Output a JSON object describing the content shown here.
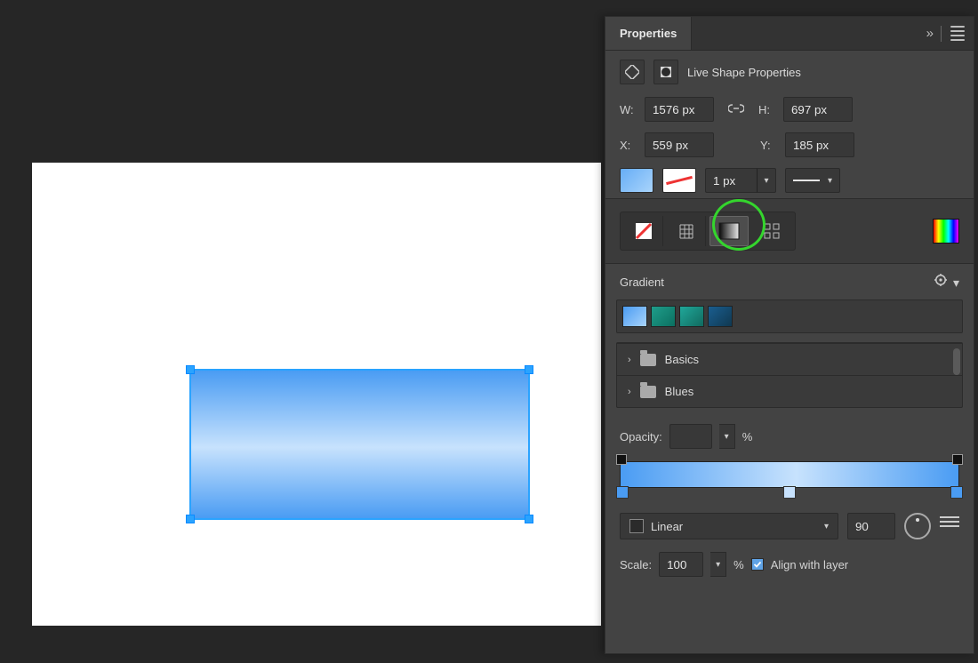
{
  "panel": {
    "title": "Properties",
    "subsection": "Live Shape Properties",
    "dims": {
      "w_label": "W:",
      "w_value": "1576 px",
      "h_label": "H:",
      "h_value": "697 px",
      "x_label": "X:",
      "x_value": "559 px",
      "y_label": "Y:",
      "y_value": "185 px"
    },
    "stroke": {
      "weight": "1 px"
    }
  },
  "gradient": {
    "heading": "Gradient",
    "folders": [
      "Basics",
      "Blues"
    ],
    "opacity_label": "Opacity:",
    "opacity_value": "",
    "opacity_unit": "%",
    "type_label": "Linear",
    "angle": "90",
    "scale_label": "Scale:",
    "scale_value": "100",
    "scale_unit": "%",
    "align_label": "Align with layer",
    "align_checked": true
  }
}
